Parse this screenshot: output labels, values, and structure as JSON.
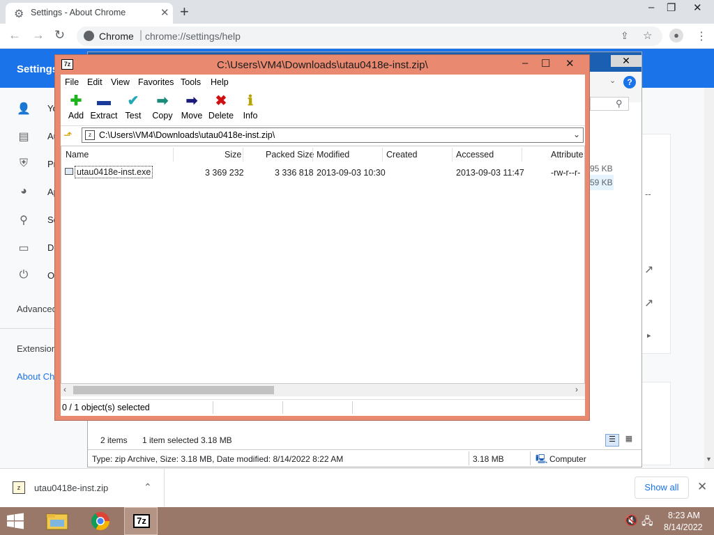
{
  "chrome": {
    "tab_title": "Settings - About Chrome",
    "omnibox_site": "Chrome",
    "omnibox_url": "chrome://settings/help",
    "win_minimize": "–",
    "win_restore": "❐",
    "win_close": "✕"
  },
  "settings": {
    "header_title": "Settings",
    "sidebar": [
      {
        "label": "Yo",
        "icon": "person-icon"
      },
      {
        "label": "Au",
        "icon": "clipboard-icon"
      },
      {
        "label": "Pr",
        "icon": "shield-icon"
      },
      {
        "label": "Ap",
        "icon": "palette-icon"
      },
      {
        "label": "Se",
        "icon": "search-icon"
      },
      {
        "label": "De",
        "icon": "browser-icon"
      },
      {
        "label": "O",
        "icon": "power-icon"
      }
    ],
    "advanced": "Advanced",
    "extensions": "Extension",
    "about": "About Ch"
  },
  "explorer": {
    "item_count": "2 items",
    "selected_info": "1 item selected",
    "selected_size": "3.18 MB",
    "status_type": "Type: zip Archive, Size: 3.18 MB, Date modified: 8/14/2022 8:22 AM",
    "status_size": "3.18 MB",
    "status_location": "Computer",
    "partial_size1": "95 KB",
    "partial_size2": "59 KB"
  },
  "sevenzip": {
    "title": "C:\\Users\\VM4\\Downloads\\utau0418e-inst.zip\\",
    "app_icon_text": "7z",
    "menu": [
      "File",
      "Edit",
      "View",
      "Favorites",
      "Tools",
      "Help"
    ],
    "toolbar": [
      {
        "label": "Add",
        "icon": "add-icon",
        "color": "#1db31d",
        "glyph": "✚"
      },
      {
        "label": "Extract",
        "icon": "extract-icon",
        "color": "#1a3a9c",
        "glyph": "▬"
      },
      {
        "label": "Test",
        "icon": "test-icon",
        "color": "#22a8b8",
        "glyph": "✔"
      },
      {
        "label": "Copy",
        "icon": "copy-icon",
        "color": "#1a8a7a",
        "glyph": "➡"
      },
      {
        "label": "Move",
        "icon": "move-icon",
        "color": "#1a1a7a",
        "glyph": "➡"
      },
      {
        "label": "Delete",
        "icon": "delete-icon",
        "color": "#d01010",
        "glyph": "✖"
      },
      {
        "label": "Info",
        "icon": "info-icon",
        "color": "#b8a400",
        "glyph": "ℹ"
      }
    ],
    "address": "C:\\Users\\VM4\\Downloads\\utau0418e-inst.zip\\",
    "columns": [
      "Name",
      "Size",
      "Packed Size",
      "Modified",
      "Created",
      "Accessed",
      "Attribute"
    ],
    "rows": [
      {
        "name": "utau0418e-inst.exe",
        "size": "3 369 232",
        "packed_size": "3 336 818",
        "modified": "2013-09-03 10:30",
        "created": "",
        "accessed": "2013-09-03 11:47",
        "attributes": "-rw-r--r-"
      }
    ],
    "status": "0 / 1 object(s) selected"
  },
  "download_bar": {
    "file_name": "utau0418e-inst.zip",
    "show_all": "Show all"
  },
  "taskbar": {
    "time": "8:23 AM",
    "date": "8/14/2022",
    "sevenzip_label": "7z"
  }
}
